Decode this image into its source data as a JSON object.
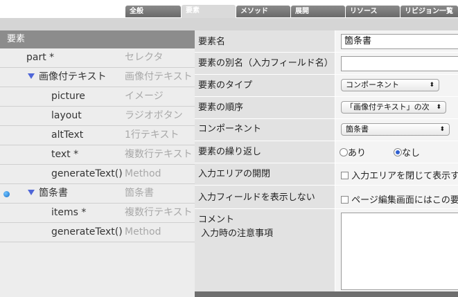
{
  "tabs": [
    {
      "label": "全般",
      "active": false
    },
    {
      "label": "要素",
      "active": true
    },
    {
      "label": "メソッド",
      "active": false
    },
    {
      "label": "展開",
      "active": false
    },
    {
      "label": "リソース",
      "active": false
    },
    {
      "label": "リビジョン一覧",
      "active": false
    }
  ],
  "sidebar": {
    "title": "要素",
    "items": [
      {
        "name": "part *",
        "type": "セレクタ"
      },
      {
        "name": "画像付テキスト",
        "type": "画像付テキスト"
      },
      {
        "name": "picture",
        "type": "イメージ"
      },
      {
        "name": "layout",
        "type": "ラジオボタン"
      },
      {
        "name": "altText",
        "type": "1行テキスト"
      },
      {
        "name": "text *",
        "type": "複数行テキスト"
      },
      {
        "name": "generateText()",
        "type": "Method"
      },
      {
        "name": "箇条書",
        "type": "箇条書"
      },
      {
        "name": "items *",
        "type": "複数行テキスト"
      },
      {
        "name": "generateText()",
        "type": "Method"
      }
    ]
  },
  "form": {
    "element_name_label": "要素名",
    "element_name_value": "箇条書",
    "alias_label": "要素の別名（入力フィールド名）",
    "alias_value": "",
    "type_label": "要素のタイプ",
    "type_value": "コンポーネント",
    "order_label": "要素の順序",
    "order_value": "「画像付テキスト」の次",
    "component_label": "コンポーネント",
    "component_value": "箇条書",
    "repeat_label": "要素の繰り返し",
    "repeat_yes": "あり",
    "repeat_no": "なし",
    "repeat_selected": "なし",
    "input_area_label": "入力エリアの開閉",
    "input_area_option": "入力エリアを閉じて表示す",
    "hide_field_label": "入力フィールドを表示しない",
    "hide_field_option": "ページ編集画面にはこの要",
    "comment_label": "コメント",
    "comment_sublabel": "入力時の注意事項",
    "comment_value": ""
  },
  "colors": {
    "accent": "#4f66d8",
    "tab_bg": "#7a7a7a",
    "sidebar_header": "#8c8c8c"
  }
}
